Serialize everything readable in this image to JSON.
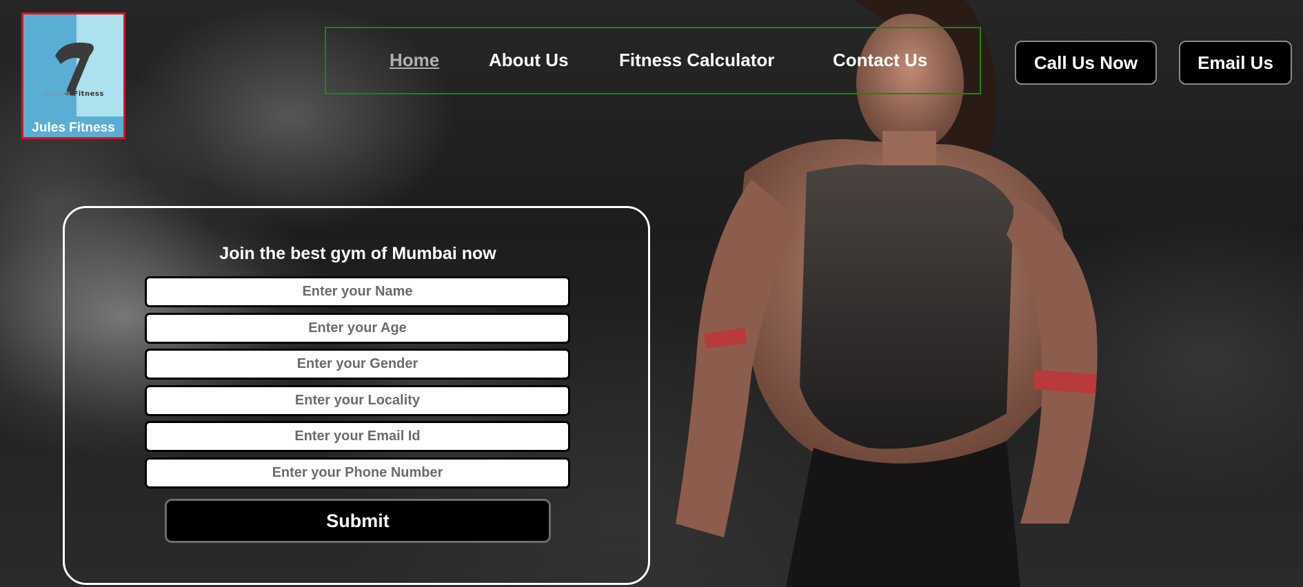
{
  "brand": {
    "logo_text_small_faded": "Health",
    "logo_text_small": "Fitness",
    "name": "Jules Fitness"
  },
  "nav": {
    "items": [
      {
        "label": "Home",
        "active": true
      },
      {
        "label": "About Us",
        "active": false
      },
      {
        "label": "Fitness Calculator",
        "active": false
      },
      {
        "label": "Contact Us",
        "active": false
      }
    ]
  },
  "cta": {
    "call_label": "Call Us Now",
    "email_label": "Email Us"
  },
  "form": {
    "title": "Join the best gym of Mumbai now",
    "fields": [
      {
        "placeholder": "Enter your Name",
        "value": ""
      },
      {
        "placeholder": "Enter your Age",
        "value": ""
      },
      {
        "placeholder": "Enter your Gender",
        "value": ""
      },
      {
        "placeholder": "Enter your Locality",
        "value": ""
      },
      {
        "placeholder": "Enter your Email Id",
        "value": ""
      },
      {
        "placeholder": "Enter your Phone Number",
        "value": ""
      }
    ],
    "submit_label": "Submit"
  },
  "colors": {
    "logo_border": "#e0121b",
    "nav_border": "#138a13",
    "logo_blue": "#5aaed4",
    "logo_light": "#aee1ee"
  },
  "icons": {
    "logo_mark": "brush-stroke-logo-icon"
  }
}
